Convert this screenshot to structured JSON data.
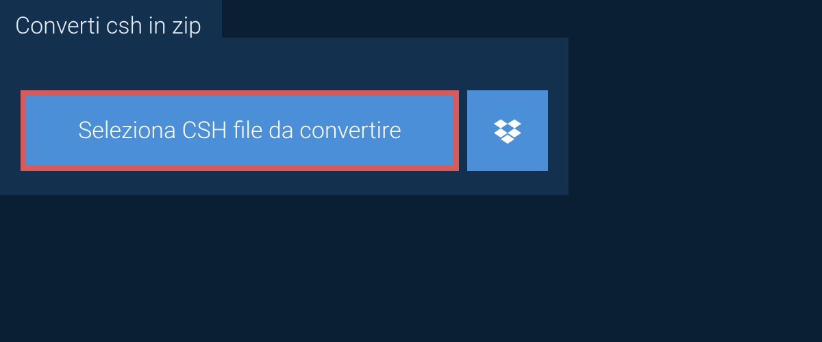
{
  "tab": {
    "label": "Converti csh in zip"
  },
  "actions": {
    "select_file_label": "Seleziona CSH file da convertire"
  }
}
